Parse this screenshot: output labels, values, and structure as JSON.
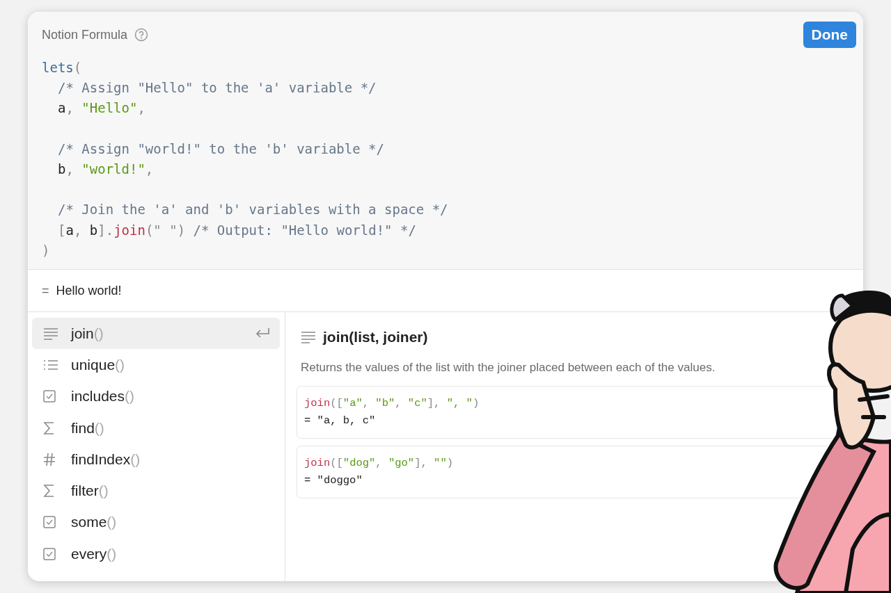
{
  "header": {
    "title": "Notion Formula",
    "done_button": "Done"
  },
  "code": {
    "lines": [
      {
        "kind": "code",
        "indent": false,
        "tokens": [
          {
            "kind": "keyword",
            "text": "lets"
          },
          {
            "kind": "punct",
            "text": "("
          }
        ]
      },
      {
        "kind": "code",
        "indent": true,
        "tokens": [
          {
            "kind": "comment",
            "text": "/* Assign \"Hello\" to the 'a' variable */"
          }
        ]
      },
      {
        "kind": "code",
        "indent": true,
        "tokens": [
          {
            "kind": "plain",
            "text": "a"
          },
          {
            "kind": "punct",
            "text": ", "
          },
          {
            "kind": "string",
            "text": "\"Hello\""
          },
          {
            "kind": "punct",
            "text": ","
          }
        ]
      },
      {
        "kind": "blank"
      },
      {
        "kind": "code",
        "indent": true,
        "tokens": [
          {
            "kind": "comment",
            "text": "/* Assign \"world!\" to the 'b' variable */"
          }
        ]
      },
      {
        "kind": "code",
        "indent": true,
        "tokens": [
          {
            "kind": "plain",
            "text": "b"
          },
          {
            "kind": "punct",
            "text": ", "
          },
          {
            "kind": "string",
            "text": "\"world!\""
          },
          {
            "kind": "punct",
            "text": ","
          }
        ]
      },
      {
        "kind": "blank"
      },
      {
        "kind": "code",
        "indent": true,
        "tokens": [
          {
            "kind": "comment",
            "text": "/* Join the 'a' and 'b' variables with a space */"
          }
        ]
      },
      {
        "kind": "code",
        "indent": true,
        "tokens": [
          {
            "kind": "punct",
            "text": "["
          },
          {
            "kind": "plain",
            "text": "a"
          },
          {
            "kind": "punct",
            "text": ", "
          },
          {
            "kind": "plain",
            "text": "b"
          },
          {
            "kind": "punct",
            "text": "]."
          },
          {
            "kind": "function",
            "text": "join"
          },
          {
            "kind": "punct",
            "text": "(\" \") "
          },
          {
            "kind": "comment",
            "text": "/* Output: \"Hello world!\" */"
          }
        ]
      },
      {
        "kind": "code",
        "indent": false,
        "tokens": [
          {
            "kind": "punct",
            "text": ")"
          }
        ]
      }
    ]
  },
  "result": {
    "sign": "=",
    "value": "Hello world!"
  },
  "functions": [
    {
      "kind": "text",
      "name": "join",
      "parens": "()",
      "selected": true
    },
    {
      "kind": "list",
      "name": "unique",
      "parens": "()",
      "selected": false
    },
    {
      "kind": "checkbox",
      "name": "includes",
      "parens": "()",
      "selected": false
    },
    {
      "kind": "sigma",
      "name": "find",
      "parens": "()",
      "selected": false
    },
    {
      "kind": "hash",
      "name": "findIndex",
      "parens": "()",
      "selected": false
    },
    {
      "kind": "sigma",
      "name": "filter",
      "parens": "()",
      "selected": false
    },
    {
      "kind": "checkbox",
      "name": "some",
      "parens": "()",
      "selected": false
    },
    {
      "kind": "checkbox",
      "name": "every",
      "parens": "()",
      "selected": false
    }
  ],
  "detail": {
    "signature": "join(list, joiner)",
    "description": "Returns the values of the list with the joiner placed between each of the values.",
    "examples": [
      {
        "call": [
          {
            "kind": "function",
            "text": "join"
          },
          {
            "kind": "punct",
            "text": "(["
          },
          {
            "kind": "string",
            "text": "\"a\""
          },
          {
            "kind": "punct",
            "text": ", "
          },
          {
            "kind": "string",
            "text": "\"b\""
          },
          {
            "kind": "punct",
            "text": ", "
          },
          {
            "kind": "string",
            "text": "\"c\""
          },
          {
            "kind": "punct",
            "text": "], "
          },
          {
            "kind": "string",
            "text": "\", \""
          },
          {
            "kind": "punct",
            "text": ")"
          }
        ],
        "result": "= \"a, b, c\""
      },
      {
        "call": [
          {
            "kind": "function",
            "text": "join"
          },
          {
            "kind": "punct",
            "text": "(["
          },
          {
            "kind": "string",
            "text": "\"dog\""
          },
          {
            "kind": "punct",
            "text": ", "
          },
          {
            "kind": "string",
            "text": "\"go\""
          },
          {
            "kind": "punct",
            "text": "], "
          },
          {
            "kind": "string",
            "text": "\"\""
          },
          {
            "kind": "punct",
            "text": ")"
          }
        ],
        "result": "= \"doggo\""
      }
    ]
  }
}
